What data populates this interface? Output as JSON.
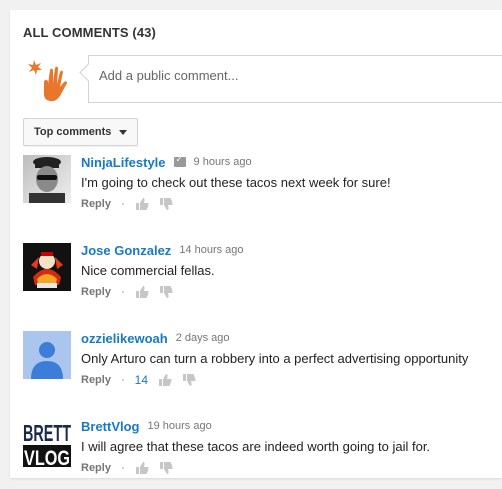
{
  "header": {
    "title": "ALL COMMENTS (43)"
  },
  "composer": {
    "placeholder": "Add a public comment..."
  },
  "sort": {
    "label": "Top comments"
  },
  "comments": [
    {
      "author": "NinjaLifestyle",
      "verified": true,
      "time": "9 hours ago",
      "text": "I'm going to check out these tacos next week for sure!",
      "reply_label": "Reply",
      "separator": "·",
      "likes": ""
    },
    {
      "author": "Jose Gonzalez",
      "verified": false,
      "time": "14 hours ago",
      "text": "Nice commercial fellas.",
      "reply_label": "Reply",
      "separator": "·",
      "likes": ""
    },
    {
      "author": "ozzielikewoah",
      "verified": false,
      "time": "2 days ago",
      "text": "Only Arturo can turn a robbery into a perfect advertising opportunity",
      "reply_label": "Reply",
      "separator": "·",
      "likes": "14"
    },
    {
      "author": "BrettVlog",
      "verified": false,
      "time": "19 hours ago",
      "text": "I will agree that these tacos are indeed worth going to jail for.",
      "reply_label": "Reply",
      "separator": "·",
      "likes": ""
    }
  ],
  "brett_avatar_text": "BRETT VLOG",
  "colors": {
    "link": "#167ac6",
    "muted": "#767676",
    "thumb": "#c6c6c6",
    "orange": "#e8762b"
  }
}
